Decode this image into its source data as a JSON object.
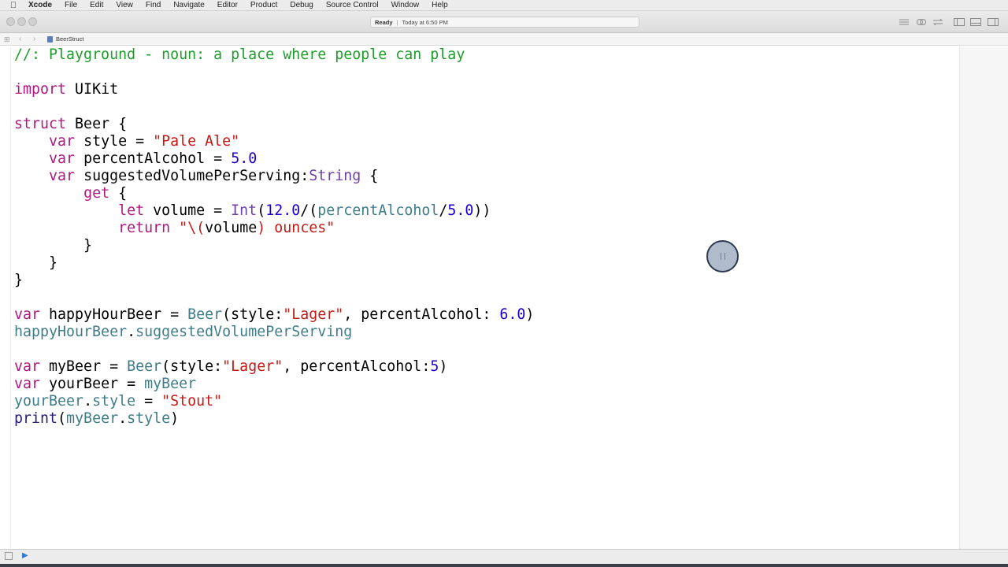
{
  "menubar": {
    "apple_icon": "apple-logo-icon",
    "items": [
      "Xcode",
      "File",
      "Edit",
      "View",
      "Find",
      "Navigate",
      "Editor",
      "Product",
      "Debug",
      "Source Control",
      "Window",
      "Help"
    ]
  },
  "toolbar": {
    "status": "Ready",
    "timestamp": "Today at 6:50 PM",
    "traffic_lights": [
      "close",
      "minimize",
      "zoom"
    ]
  },
  "jumpbar": {
    "file_name": "BeerStruct"
  },
  "code_lines": [
    [
      {
        "t": "//: Playground - noun: a place where people can play",
        "c": "cm"
      }
    ],
    [],
    [
      {
        "t": "import",
        "c": "kw"
      },
      {
        "t": " UIKit",
        "c": ""
      }
    ],
    [],
    [
      {
        "t": "struct",
        "c": "kw"
      },
      {
        "t": " Beer {",
        "c": ""
      }
    ],
    [
      {
        "t": "    ",
        "c": ""
      },
      {
        "t": "var",
        "c": "kw"
      },
      {
        "t": " style = ",
        "c": ""
      },
      {
        "t": "\"Pale Ale\"",
        "c": "str"
      }
    ],
    [
      {
        "t": "    ",
        "c": ""
      },
      {
        "t": "var",
        "c": "kw"
      },
      {
        "t": " percentAlcohol = ",
        "c": ""
      },
      {
        "t": "5.0",
        "c": "num"
      }
    ],
    [
      {
        "t": "    ",
        "c": ""
      },
      {
        "t": "var",
        "c": "kw"
      },
      {
        "t": " suggestedVolumePerServing:",
        "c": ""
      },
      {
        "t": "String",
        "c": "ty"
      },
      {
        "t": " {",
        "c": ""
      }
    ],
    [
      {
        "t": "        ",
        "c": ""
      },
      {
        "t": "get",
        "c": "kw"
      },
      {
        "t": " {",
        "c": ""
      }
    ],
    [
      {
        "t": "            ",
        "c": ""
      },
      {
        "t": "let",
        "c": "kw"
      },
      {
        "t": " volume = ",
        "c": ""
      },
      {
        "t": "Int",
        "c": "ty"
      },
      {
        "t": "(",
        "c": ""
      },
      {
        "t": "12.0",
        "c": "num"
      },
      {
        "t": "/(",
        "c": ""
      },
      {
        "t": "percentAlcohol",
        "c": "pr"
      },
      {
        "t": "/",
        "c": ""
      },
      {
        "t": "5.0",
        "c": "num"
      },
      {
        "t": "))",
        "c": ""
      }
    ],
    [
      {
        "t": "            ",
        "c": ""
      },
      {
        "t": "return",
        "c": "kw"
      },
      {
        "t": " ",
        "c": ""
      },
      {
        "t": "\"\\(",
        "c": "str"
      },
      {
        "t": "volume",
        "c": ""
      },
      {
        "t": ") ounces\"",
        "c": "str"
      }
    ],
    [
      {
        "t": "        }",
        "c": ""
      }
    ],
    [
      {
        "t": "    }",
        "c": ""
      }
    ],
    [
      {
        "t": "}",
        "c": ""
      }
    ],
    [],
    [
      {
        "t": "var",
        "c": "kw"
      },
      {
        "t": " happyHourBeer = ",
        "c": ""
      },
      {
        "t": "Beer",
        "c": "pr"
      },
      {
        "t": "(style:",
        "c": ""
      },
      {
        "t": "\"Lager\"",
        "c": "str"
      },
      {
        "t": ", percentAlcohol: ",
        "c": ""
      },
      {
        "t": "6.0",
        "c": "num"
      },
      {
        "t": ")",
        "c": ""
      }
    ],
    [
      {
        "t": "happyHourBeer",
        "c": "pr"
      },
      {
        "t": ".",
        "c": ""
      },
      {
        "t": "suggestedVolumePerServing",
        "c": "pr"
      }
    ],
    [],
    [
      {
        "t": "var",
        "c": "kw"
      },
      {
        "t": " myBeer = ",
        "c": ""
      },
      {
        "t": "Beer",
        "c": "pr"
      },
      {
        "t": "(style:",
        "c": ""
      },
      {
        "t": "\"Lager\"",
        "c": "str"
      },
      {
        "t": ", percentAlcohol:",
        "c": ""
      },
      {
        "t": "5",
        "c": "num"
      },
      {
        "t": ")",
        "c": ""
      }
    ],
    [
      {
        "t": "var",
        "c": "kw"
      },
      {
        "t": " yourBeer = ",
        "c": ""
      },
      {
        "t": "myBeer",
        "c": "pr"
      }
    ],
    [
      {
        "t": "yourBeer",
        "c": "pr"
      },
      {
        "t": ".",
        "c": ""
      },
      {
        "t": "style",
        "c": "pr"
      },
      {
        "t": " = ",
        "c": ""
      },
      {
        "t": "\"Stout\"",
        "c": "str"
      }
    ],
    [
      {
        "t": "print",
        "c": "fn"
      },
      {
        "t": "(",
        "c": ""
      },
      {
        "t": "myBeer",
        "c": "pr"
      },
      {
        "t": ".",
        "c": ""
      },
      {
        "t": "style",
        "c": "pr"
      },
      {
        "t": ")",
        "c": ""
      }
    ]
  ],
  "colors": {
    "comment": "#1e9d2a",
    "keyword": "#b0177f",
    "string": "#c41a16",
    "number": "#1c00cf",
    "type": "#6f41a8",
    "project_symbol": "#3f7c8a"
  }
}
